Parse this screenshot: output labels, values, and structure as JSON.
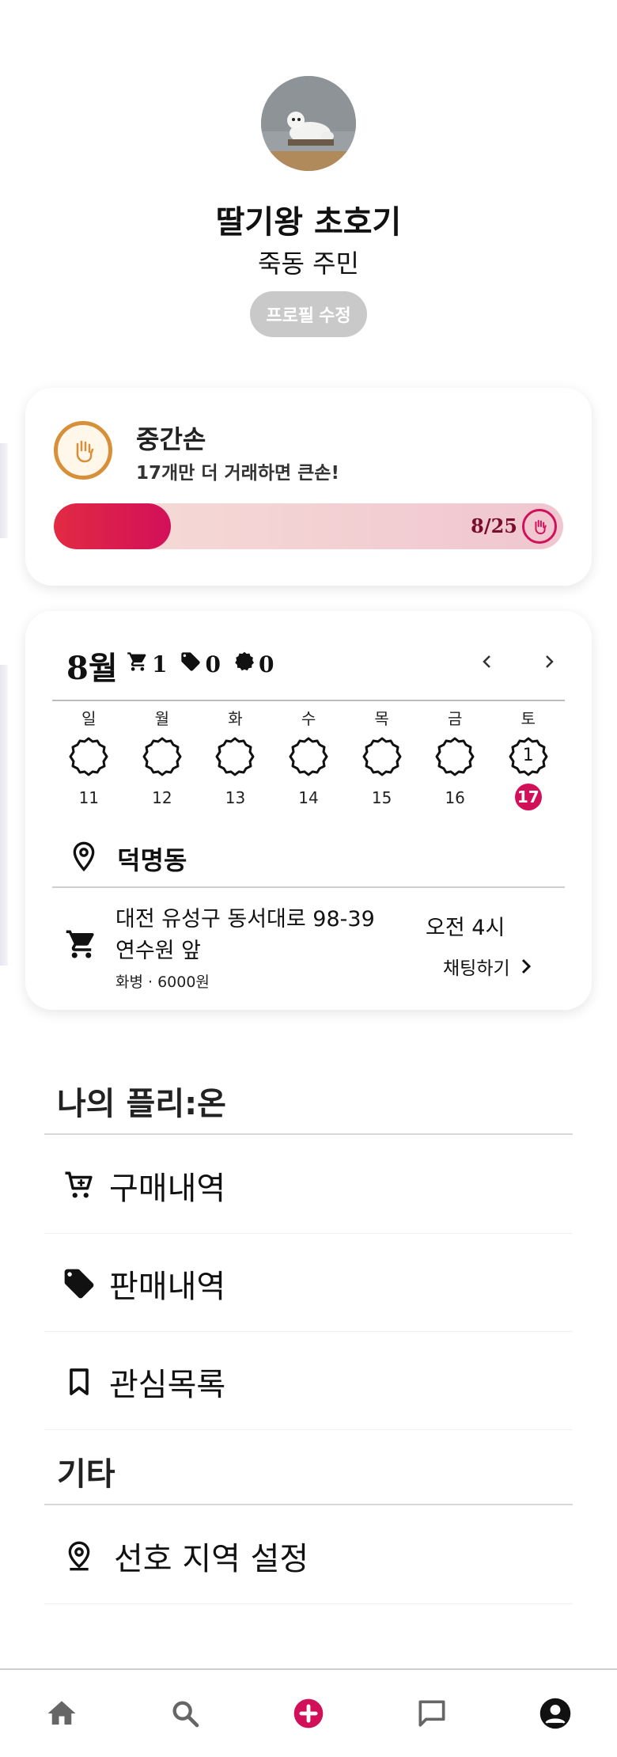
{
  "profile": {
    "name": "딸기왕 초호기",
    "subtitle": "죽동 주민",
    "edit_label": "프로필 수정"
  },
  "level": {
    "title": "중간손",
    "subtitle": "17개만 더 거래하면 큰손!",
    "progress_text": "8/25",
    "progress_current": 8,
    "progress_total": 25,
    "accent": "#d2105a"
  },
  "calendar": {
    "month": "8월",
    "stats": {
      "buy": "1",
      "sell": "0",
      "other": "0"
    },
    "weekdays": [
      "일",
      "월",
      "화",
      "수",
      "목",
      "금",
      "토"
    ],
    "dates": [
      "11",
      "12",
      "13",
      "14",
      "15",
      "16",
      "17"
    ],
    "badge_count": "1",
    "today": "17"
  },
  "transaction": {
    "location": "덕명동",
    "address_line1": "대전 유성구 동서대로 98-39",
    "address_line2": "연수원 앞",
    "meta": "화병 · 6000원",
    "time": "오전 4시",
    "chat_label": "채팅하기"
  },
  "menu": {
    "my_section_title": "나의 플리:온",
    "purchase_label": "구매내역",
    "sales_label": "판매내역",
    "wishlist_label": "관심목록",
    "etc_section_title": "기타",
    "region_label": "선호 지역 설정"
  },
  "bottom_nav": [
    "home-icon",
    "search-icon",
    "add-icon",
    "chat-icon",
    "account-icon"
  ]
}
